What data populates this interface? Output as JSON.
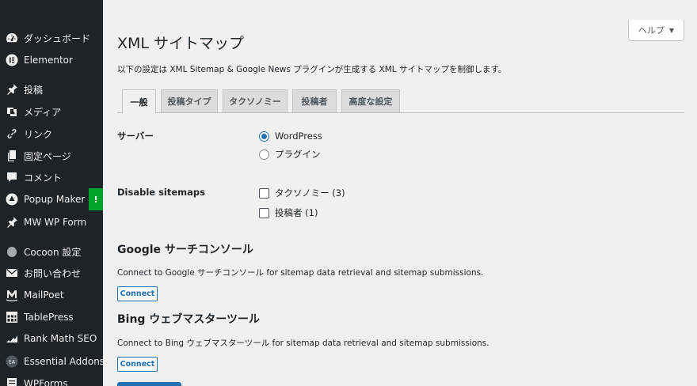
{
  "sidebar": {
    "items": [
      {
        "label": "ダッシュボード",
        "icon": "dashboard-icon"
      },
      {
        "label": "Elementor",
        "icon": "elementor-icon"
      },
      {
        "label": "投稿",
        "icon": "pin-icon"
      },
      {
        "label": "メディア",
        "icon": "media-icon"
      },
      {
        "label": "リンク",
        "icon": "link-icon"
      },
      {
        "label": "固定ページ",
        "icon": "page-icon"
      },
      {
        "label": "コメント",
        "icon": "comment-icon"
      },
      {
        "label": "Popup Maker",
        "icon": "popup-maker-icon",
        "badge": "!"
      },
      {
        "label": "MW WP Form",
        "icon": "pin-icon"
      },
      {
        "label": "Cocoon 設定",
        "icon": "cocoon-icon"
      },
      {
        "label": "お問い合わせ",
        "icon": "mail-icon"
      },
      {
        "label": "MailPoet",
        "icon": "mailpoet-icon"
      },
      {
        "label": "TablePress",
        "icon": "table-icon"
      },
      {
        "label": "Rank Math SEO",
        "icon": "rank-math-icon"
      },
      {
        "label": "Essential Addons",
        "icon": "essential-addons-icon"
      },
      {
        "label": "WPForms",
        "icon": "wpforms-icon"
      }
    ],
    "colors": {
      "bg": "#1d2327",
      "badge": "#00a32a"
    }
  },
  "header": {
    "help_label": "ヘルプ",
    "title": "XML サイトマップ",
    "description": "以下の設定は XML Sitemap & Google News プラグインが生成する XML サイトマップを制御します。"
  },
  "tabs": [
    {
      "label": "一般",
      "active": true
    },
    {
      "label": "投稿タイプ",
      "active": false
    },
    {
      "label": "タクソノミー",
      "active": false
    },
    {
      "label": "投稿者",
      "active": false
    },
    {
      "label": "高度な設定",
      "active": false
    }
  ],
  "settings": {
    "server": {
      "label": "サーバー",
      "options": [
        {
          "label": "WordPress",
          "checked": true
        },
        {
          "label": "プラグイン",
          "checked": false
        }
      ]
    },
    "disable_sitemaps": {
      "label": "Disable sitemaps",
      "options": [
        {
          "label": "タクソノミー (3)",
          "checked": false
        },
        {
          "label": "投稿者 (1)",
          "checked": false
        }
      ]
    }
  },
  "sections": {
    "google": {
      "heading": "Google サーチコンソール",
      "text": "Connect to Google サーチコンソール for sitemap data retrieval and sitemap submissions.",
      "button": "Connect"
    },
    "bing": {
      "heading": "Bing ウェブマスターツール",
      "text": "Connect to Bing ウェブマスターツール for sitemap data retrieval and sitemap submissions.",
      "button": "Connect"
    }
  },
  "colors": {
    "accent": "#2271b1",
    "page_bg": "#f0f0f1"
  }
}
